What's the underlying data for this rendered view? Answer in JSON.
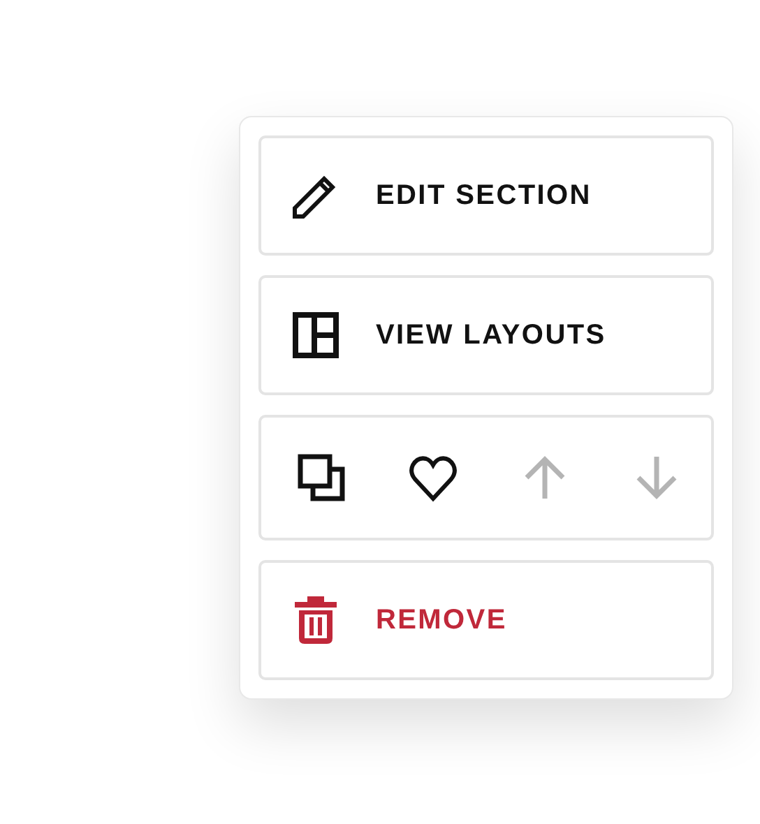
{
  "menu": [
    {
      "kind": "edit",
      "label": "EDIT SECTION",
      "danger": false
    },
    {
      "kind": "layouts",
      "label": "VIEW LAYOUTS",
      "danger": false
    },
    {
      "kind": "icons",
      "buttons": [
        {
          "kind": "duplicate",
          "disabled": false
        },
        {
          "kind": "favorite",
          "disabled": false
        },
        {
          "kind": "move-up",
          "disabled": true
        },
        {
          "kind": "move-down",
          "disabled": true
        }
      ]
    },
    {
      "kind": "remove",
      "label": "REMOVE",
      "danger": true
    }
  ]
}
